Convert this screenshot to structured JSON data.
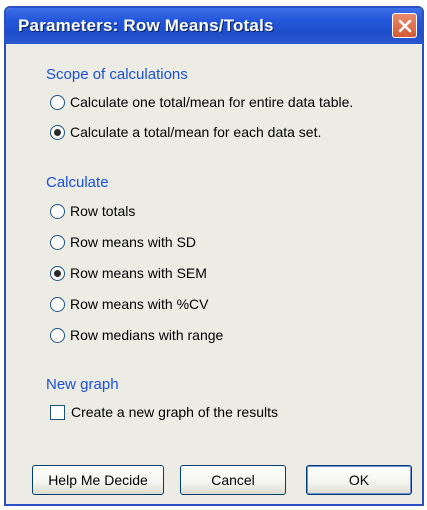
{
  "dialog": {
    "title": "Parameters: Row Means/Totals"
  },
  "scope": {
    "label": "Scope of calculations",
    "options": [
      {
        "label": "Calculate one total/mean for entire data table.",
        "selected": false
      },
      {
        "label": "Calculate a total/mean for each data set.",
        "selected": true
      }
    ]
  },
  "calculate": {
    "label": "Calculate",
    "options": [
      {
        "label": "Row totals",
        "selected": false
      },
      {
        "label": "Row means with SD",
        "selected": false
      },
      {
        "label": "Row means with SEM",
        "selected": true
      },
      {
        "label": "Row means with %CV",
        "selected": false
      },
      {
        "label": "Row medians with range",
        "selected": false
      }
    ]
  },
  "new_graph": {
    "label": "New graph",
    "checkbox_label": "Create a new graph of the results",
    "checked": false
  },
  "buttons": {
    "help": "Help Me Decide",
    "cancel": "Cancel",
    "ok": "OK"
  },
  "colors": {
    "titlebar": "#2356db",
    "section_label": "#1a4fd8",
    "dialog_bg": "#ecece4"
  },
  "icons": {
    "close": "close-icon"
  }
}
